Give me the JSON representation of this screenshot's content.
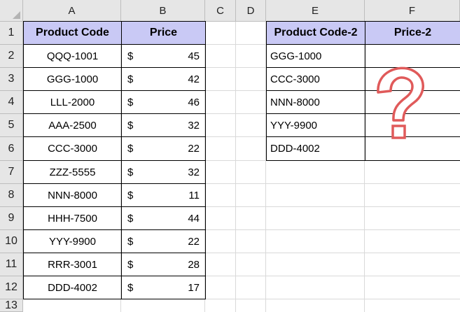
{
  "columns": [
    "A",
    "B",
    "C",
    "D",
    "E",
    "F"
  ],
  "rows": [
    "1",
    "2",
    "3",
    "4",
    "5",
    "6",
    "7",
    "8",
    "9",
    "10",
    "11",
    "12",
    "13"
  ],
  "table1": {
    "header": {
      "code": "Product Code",
      "price": "Price"
    },
    "currency": "$",
    "items": [
      {
        "code": "QQQ-1001",
        "price": "45"
      },
      {
        "code": "GGG-1000",
        "price": "42"
      },
      {
        "code": "LLL-2000",
        "price": "46"
      },
      {
        "code": "AAA-2500",
        "price": "32"
      },
      {
        "code": "CCC-3000",
        "price": "22"
      },
      {
        "code": "ZZZ-5555",
        "price": "32"
      },
      {
        "code": "NNN-8000",
        "price": "11"
      },
      {
        "code": "HHH-7500",
        "price": "44"
      },
      {
        "code": "YYY-9900",
        "price": "22"
      },
      {
        "code": "RRR-3001",
        "price": "28"
      },
      {
        "code": "DDD-4002",
        "price": "17"
      }
    ]
  },
  "table2": {
    "header": {
      "code": "Product Code-2",
      "price": "Price-2"
    },
    "items": [
      {
        "code": "GGG-1000",
        "price": ""
      },
      {
        "code": "CCC-3000",
        "price": ""
      },
      {
        "code": "NNN-8000",
        "price": ""
      },
      {
        "code": "YYY-9900",
        "price": ""
      },
      {
        "code": "DDD-4002",
        "price": ""
      }
    ]
  },
  "colors": {
    "header_fill": "#c9c9f5",
    "question_mark": "#e05a5a",
    "gridline": "#d9d9d9"
  }
}
